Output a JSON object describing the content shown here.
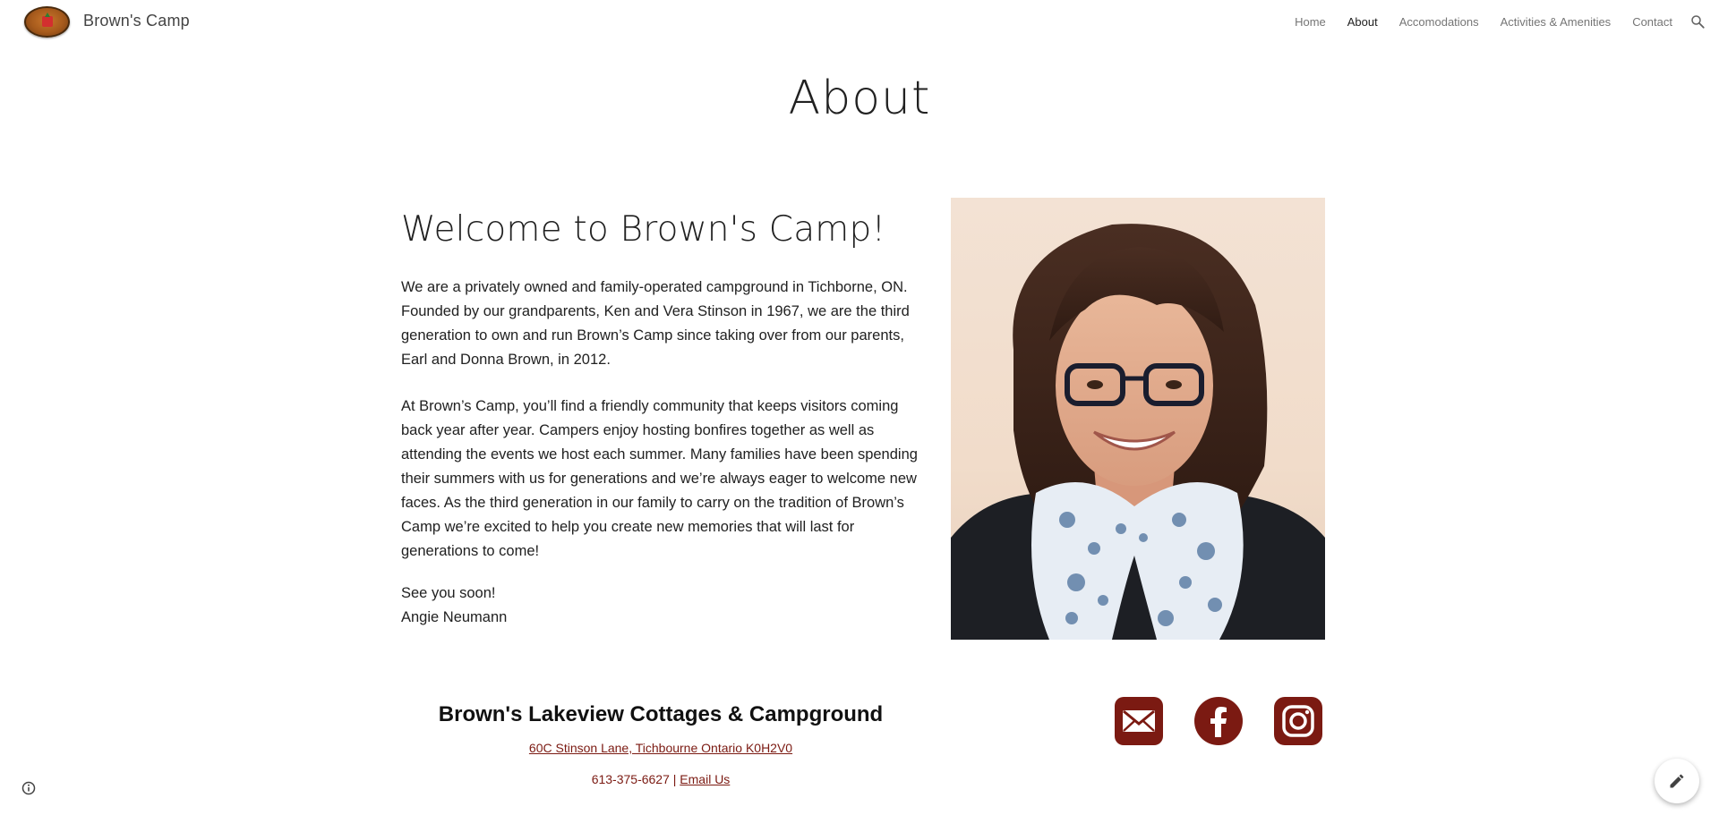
{
  "header": {
    "site_title": "Brown's Camp",
    "nav": [
      {
        "label": "Home",
        "active": false
      },
      {
        "label": "About",
        "active": true
      },
      {
        "label": "Accomodations",
        "active": false
      },
      {
        "label": "Activities & Amenities",
        "active": false
      },
      {
        "label": "Contact",
        "active": false
      }
    ],
    "icons": {
      "search": "search-icon",
      "logo": "camp-logo"
    }
  },
  "main": {
    "page_title": "About",
    "welcome_heading": "Welcome to Brown's Camp!",
    "paragraph1": "We are a privately owned and family-operated campground in Tichborne, ON. Founded by our grandparents, Ken and Vera Stinson in 1967, we are the third generation to own and run Brown’s Camp since taking over from our parents, Earl and Donna Brown, in 2012.",
    "paragraph2": "At Brown’s Camp, you’ll find a friendly community that keeps visitors coming back year after year. Campers enjoy hosting bonfires together as well as attending the events we host each summer. Many families have been spending their summers with us for generations and we’re always eager to welcome new faces. As the third generation in our family to carry on the tradition of Brown’s Camp we’re excited to help you create new memories that will last for generations to come!",
    "signoff_line1": "See you soon!",
    "signoff_line2": "Angie Neumann"
  },
  "footer": {
    "title": "Brown's Lakeview Cottages & Campground",
    "address": "60C Stinson Lane, Tichbourne Ontario K0H2V0",
    "phone": "613-375-6627",
    "separator": "|",
    "email_link": "Email Us",
    "social_icons": [
      "email-icon",
      "facebook-icon",
      "instagram-icon"
    ]
  },
  "colors": {
    "accent": "#7b1a12",
    "text": "#212121",
    "nav_inactive": "#757575"
  }
}
